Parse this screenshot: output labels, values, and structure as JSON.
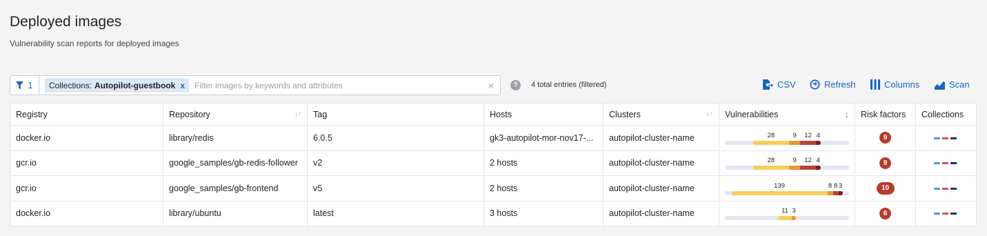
{
  "header": {
    "title": "Deployed images",
    "subtitle": "Vulnerability scan reports for deployed images"
  },
  "filter": {
    "count": "1",
    "chip_key": "Collections:",
    "chip_value": "Autopilot-guestbook",
    "chip_close": "x",
    "placeholder": "Filter images by keywords and attributes",
    "clear": "×",
    "help": "?",
    "entries": "4 total entries (filtered)"
  },
  "toolbar": {
    "csv": "CSV",
    "refresh": "Refresh",
    "columns": "Columns",
    "scan": "Scan"
  },
  "colors": {
    "accent": "#1a64c4",
    "low": "#f3cf5d",
    "medium": "#e49a3b",
    "high": "#b8433a",
    "critical": "#861818",
    "risk": "#b83a2d",
    "collection_blue": "#4a9fe0",
    "collection_red": "#d9534f",
    "collection_navy": "#1f2d86"
  },
  "table": {
    "headers": {
      "registry": "Registry",
      "repository": "Repository",
      "tag": "Tag",
      "hosts": "Hosts",
      "clusters": "Clusters",
      "vulnerabilities": "Vulnerabilities",
      "risk": "Risk factors",
      "collections": "Collections"
    },
    "rows": [
      {
        "registry": "docker.io",
        "repository": "library/redis",
        "tag": "6.0.5",
        "hosts": "gk3-autopilot-mor-nov17-...",
        "cluster": "autopilot-cluster-name",
        "vuln": {
          "low": "28",
          "medium": "9",
          "high": "12",
          "critical": "4"
        },
        "risk": "9"
      },
      {
        "registry": "gcr.io",
        "repository": "google_samples/gb-redis-follower",
        "tag": "v2",
        "hosts": "2 hosts",
        "cluster": "autopilot-cluster-name",
        "vuln": {
          "low": "28",
          "medium": "9",
          "high": "12",
          "critical": "4"
        },
        "risk": "9"
      },
      {
        "registry": "gcr.io",
        "repository": "google_samples/gb-frontend",
        "tag": "v5",
        "hosts": "2 hosts",
        "cluster": "autopilot-cluster-name",
        "vuln": {
          "low": "139",
          "medium": "8",
          "high": "8",
          "critical": "3"
        },
        "risk": "10"
      },
      {
        "registry": "docker.io",
        "repository": "library/ubuntu",
        "tag": "latest",
        "hosts": "3 hosts",
        "cluster": "autopilot-cluster-name",
        "vuln": {
          "low": "11",
          "medium": "3",
          "high": "",
          "critical": ""
        },
        "risk": "6"
      }
    ]
  }
}
